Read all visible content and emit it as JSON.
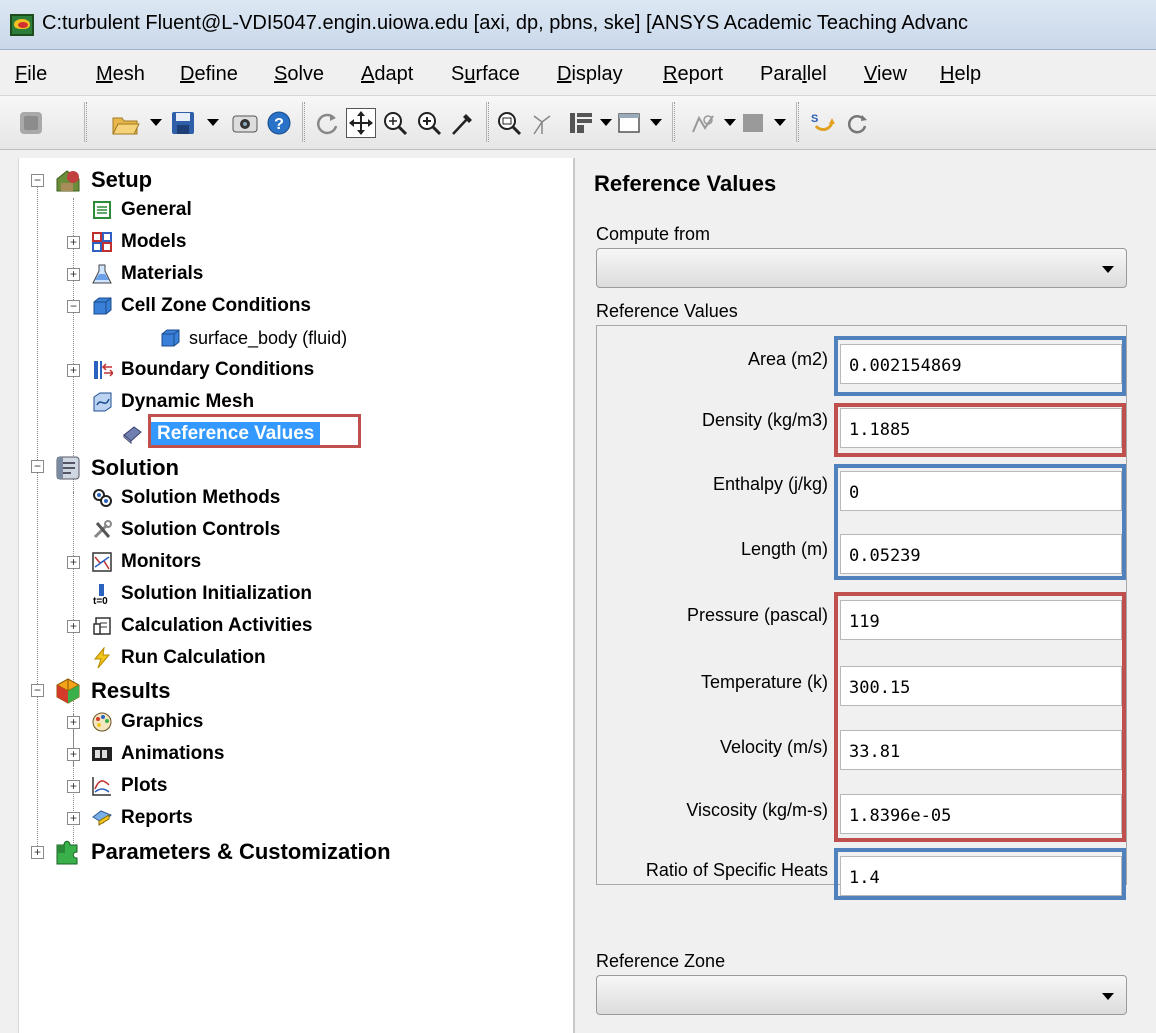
{
  "window": {
    "title": "C:turbulent Fluent@L-VDI5047.engin.uiowa.edu  [axi, dp, pbns, ske] [ANSYS Academic Teaching Advanc"
  },
  "menu": [
    {
      "label": "File",
      "ul": "F",
      "rest": "ile"
    },
    {
      "label": "Mesh",
      "ul": "M",
      "rest": "esh"
    },
    {
      "label": "Define",
      "ul": "D",
      "rest": "efine"
    },
    {
      "label": "Solve",
      "ul": "S",
      "rest": "olve"
    },
    {
      "label": "Adapt",
      "ul": "A",
      "rest": "dapt"
    },
    {
      "label": "Surface",
      "ul": "S",
      "rest": "urface",
      "pre": "S"
    },
    {
      "label": "Display",
      "ul": "D",
      "rest": "isplay"
    },
    {
      "label": "Report",
      "ul": "R",
      "rest": "eport"
    },
    {
      "label": "Parallel",
      "ul": "l",
      "rest": ""
    },
    {
      "label": "View",
      "ul": "V",
      "rest": "iew"
    },
    {
      "label": "Help",
      "ul": "H",
      "rest": "elp"
    }
  ],
  "toolbar": {
    "icons": [
      "tb-disabled-icon",
      "open-folder-icon",
      "save-icon",
      "screenshot-icon",
      "help-icon",
      "rotate-icon",
      "pan-icon",
      "zoom-fit-icon",
      "zoom-in-icon",
      "probe-icon",
      "zoom-to-area-icon",
      "orient-icon",
      "layout-icon",
      "window-icon",
      "view-icon",
      "color-icon",
      "iterate-icon",
      "refresh-icon"
    ]
  },
  "tree": {
    "setup": {
      "label": "Setup",
      "icon": "setup-icon"
    },
    "general": {
      "label": "General",
      "icon": "general-icon"
    },
    "models": {
      "label": "Models",
      "icon": "models-icon"
    },
    "materials": {
      "label": "Materials",
      "icon": "flask-icon"
    },
    "cell_zone": {
      "label": "Cell Zone Conditions",
      "icon": "cube-icon"
    },
    "surface_body": {
      "label": "surface_body (fluid)",
      "icon": "cube-icon"
    },
    "boundary": {
      "label": "Boundary Conditions",
      "icon": "boundary-icon"
    },
    "dynamic_mesh": {
      "label": "Dynamic Mesh",
      "icon": "dynamic-mesh-icon"
    },
    "reference_values": {
      "label": "Reference Values",
      "icon": "book-icon"
    },
    "solution": {
      "label": "Solution",
      "icon": "solution-icon"
    },
    "solution_methods": {
      "label": "Solution Methods",
      "icon": "methods-icon"
    },
    "solution_controls": {
      "label": "Solution Controls",
      "icon": "tools-icon"
    },
    "monitors": {
      "label": "Monitors",
      "icon": "monitor-icon"
    },
    "solution_init": {
      "label": "Solution Initialization",
      "icon": "init-icon",
      "sub": "t=0"
    },
    "calc_activities": {
      "label": "Calculation Activities",
      "icon": "activities-icon"
    },
    "run_calc": {
      "label": "Run Calculation",
      "icon": "lightning-icon"
    },
    "results": {
      "label": "Results",
      "icon": "results-icon"
    },
    "graphics": {
      "label": "Graphics",
      "icon": "palette-icon"
    },
    "animations": {
      "label": "Animations",
      "icon": "film-icon"
    },
    "plots": {
      "label": "Plots",
      "icon": "plot-icon"
    },
    "reports": {
      "label": "Reports",
      "icon": "report-icon"
    },
    "parameters": {
      "label": "Parameters & Customization",
      "icon": "puzzle-icon"
    }
  },
  "panel": {
    "title": "Reference Values",
    "compute_from_label": "Compute from",
    "compute_from_value": "",
    "group_label": "Reference Values",
    "fields": [
      {
        "label": "Area (m2)",
        "value": "0.002154869"
      },
      {
        "label": "Density (kg/m3)",
        "value": "1.1885"
      },
      {
        "label": "Enthalpy (j/kg)",
        "value": "0"
      },
      {
        "label": "Length (m)",
        "value": "0.05239"
      },
      {
        "label": "Pressure (pascal)",
        "value": "119"
      },
      {
        "label": "Temperature (k)",
        "value": "300.15"
      },
      {
        "label": "Velocity (m/s)",
        "value": "33.81"
      },
      {
        "label": "Viscosity (kg/m-s)",
        "value": "1.8396e-05"
      },
      {
        "label": "Ratio of Specific Heats",
        "value": "1.4"
      }
    ],
    "reference_zone_label": "Reference Zone",
    "reference_zone_value": ""
  },
  "highlight_colors": {
    "blue": "#4f81bd",
    "red": "#c0504d",
    "selection": "#3399ff"
  }
}
